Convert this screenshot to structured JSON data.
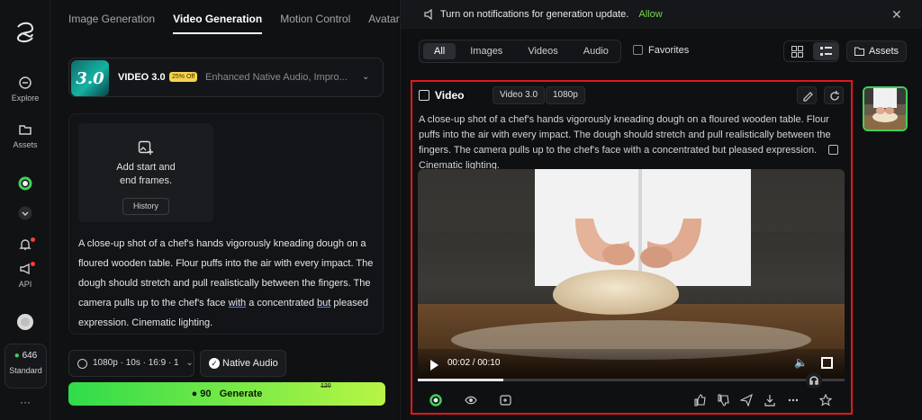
{
  "rail": {
    "explore": "Explore",
    "assets": "Assets",
    "api": "API",
    "credits": "646",
    "plan": "Standard",
    "more": "···"
  },
  "tabs": [
    "Image Generation",
    "Video Generation",
    "Motion Control",
    "Avatar"
  ],
  "active_tab_index": 1,
  "model": {
    "logo_text": "3.0",
    "name": "VIDEO 3.0",
    "badge": "25% Off",
    "description": "Enhanced Native Audio, Impro..."
  },
  "frames": {
    "line1": "Add start and",
    "line2": "end frames.",
    "history": "History"
  },
  "prompt_parts": {
    "a": "A close-up shot of a chef's hands vigorously kneading dough on a floured wooden table. Flour puffs into the air with every impact. The dough should stretch and pull realistically between the fingers. The camera pulls up to the chef's face ",
    "b": "with",
    "c": " a concentrated ",
    "d": "but",
    "e": " pleased expression. Cinematic lighting."
  },
  "options_label": "1080p · 10s · 16:9 · 1",
  "native_audio": "Native Audio",
  "generate": {
    "cost": "90",
    "label": "Generate",
    "old_cost": "120"
  },
  "notification": {
    "text": "Turn on notifications for generation update.",
    "allow": "Allow"
  },
  "filters": [
    "All",
    "Images",
    "Videos",
    "Audio"
  ],
  "active_filter_index": 0,
  "favorites": "Favorites",
  "assets_button": "Assets",
  "result": {
    "title": "Video",
    "chips": [
      "Video 3.0",
      "1080p"
    ],
    "description": "A close-up shot of a chef's hands vigorously kneading dough on a floured wooden table. Flour puffs into the air with every impact. The dough should stretch and pull realistically between the fingers. The camera pulls up to the chef's face with a concentrated but pleased expression. Cinematic lighting.",
    "time": "00:02 / 00:10",
    "progress": 0.2
  },
  "colors": {
    "accent_green": "#3fd15a",
    "allow_green": "#6ed94b",
    "selection_red": "#e4161e",
    "badge_yellow": "#f6d34b"
  }
}
